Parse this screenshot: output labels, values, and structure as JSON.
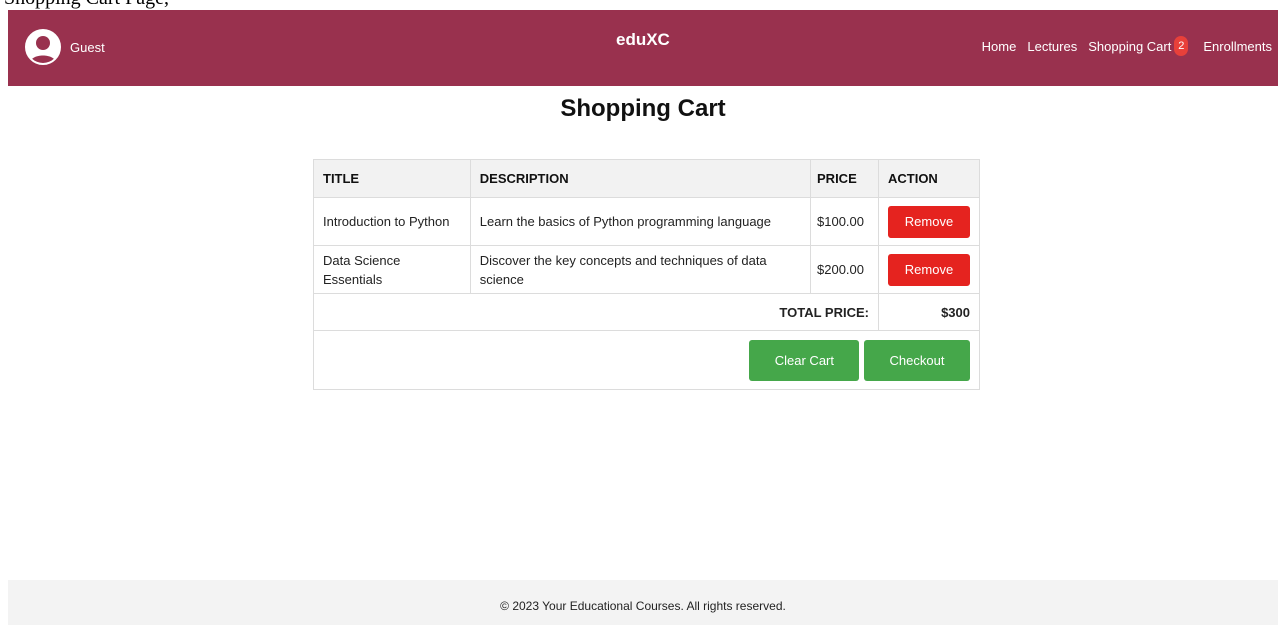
{
  "browser_tab_strip": {
    "text": "Shopping Cart Page, "
  },
  "navbar": {
    "user_name": "Guest",
    "brand": "eduXC",
    "links": [
      {
        "label": "Home"
      },
      {
        "label": "Lectures"
      },
      {
        "label": "Shopping Cart",
        "badge": "2"
      },
      {
        "label": "Enrollments"
      }
    ],
    "background": "#99314e"
  },
  "page": {
    "title": "Shopping Cart"
  },
  "cart": {
    "headers": {
      "title": "TITLE",
      "description": "DESCRIPTION",
      "price": "PRICE",
      "action": "ACTION"
    },
    "items": [
      {
        "title": "Introduction to Python",
        "description": "Learn the basics of Python programming language",
        "price": "$100.00",
        "action_label": "Remove"
      },
      {
        "title": "Data Science Essentials",
        "description": "Discover the key concepts and techniques of data science",
        "price": "$200.00",
        "action_label": "Remove"
      }
    ],
    "total_label": "TOTAL PRICE:",
    "total_value": "$300",
    "clear_label": "Clear Cart",
    "checkout_label": "Checkout",
    "remove_color": "#e5231f",
    "action_color": "#45a74a"
  },
  "footer": {
    "text": "© 2023 Your Educational Courses. All rights reserved."
  }
}
